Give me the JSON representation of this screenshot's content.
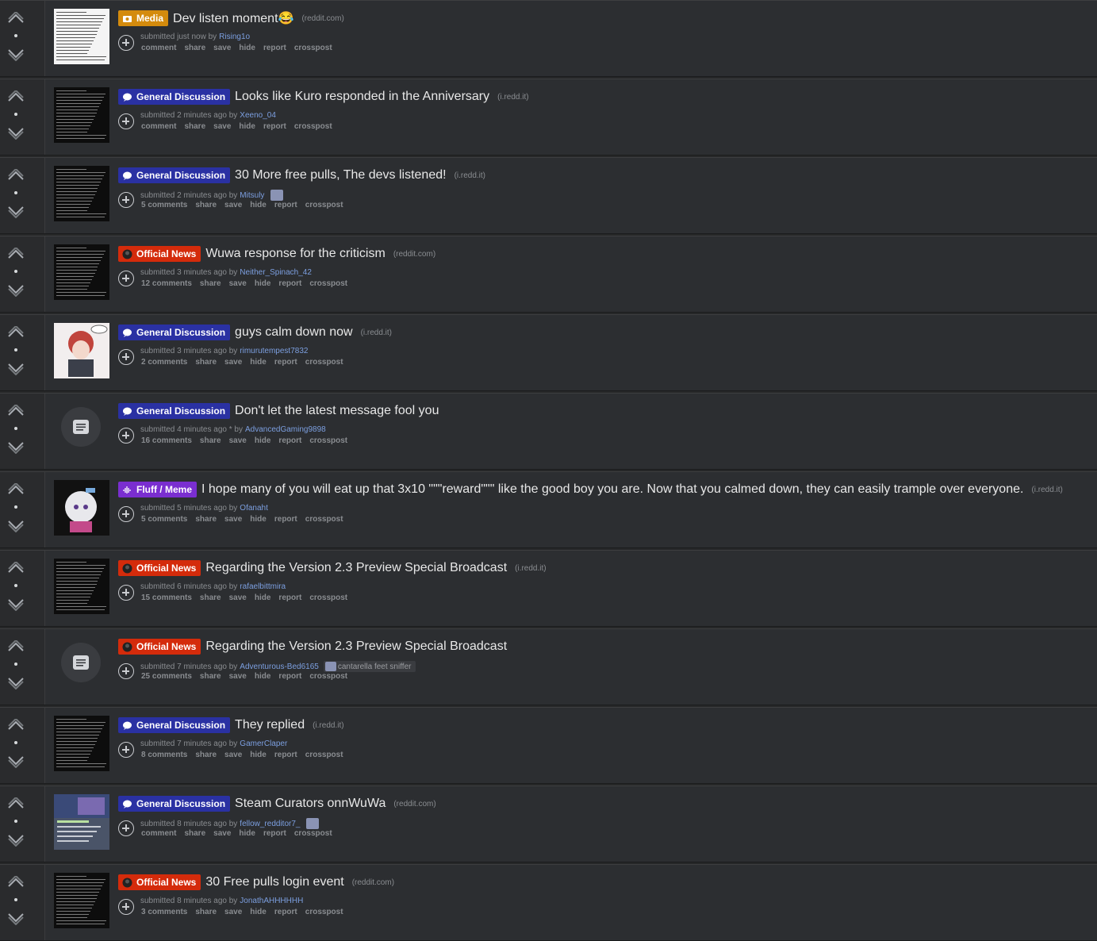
{
  "colors": {
    "media": "#d48b0d",
    "general_discussion": "#2a31a3",
    "official_news": "#d42b0b",
    "fluff_meme": "#7a2ed0"
  },
  "buttons": {
    "comment": "comment",
    "share": "share",
    "save": "save",
    "hide": "hide",
    "report": "report",
    "crosspost": "crosspost"
  },
  "posts": [
    {
      "flair": "Media",
      "flair_type": "media",
      "title": "Dev listen moment😂",
      "domain": "(reddit.com)",
      "submitted": "submitted just now by",
      "author": "Rising1o",
      "comments": "comment",
      "thumb": "light"
    },
    {
      "flair": "General Discussion",
      "flair_type": "gd",
      "title": "Looks like Kuro responded in the Anniversary",
      "domain": "(i.redd.it)",
      "submitted": "submitted 2 minutes ago by",
      "author": "Xeeno_04",
      "comments": "comment",
      "thumb": "dark"
    },
    {
      "flair": "General Discussion",
      "flair_type": "gd",
      "title": "30 More free pulls, The devs listened!",
      "domain": "(i.redd.it)",
      "submitted": "submitted 2 minutes ago by",
      "author": "Mitsuly",
      "comments": "5 comments",
      "thumb": "dark",
      "avatar": true
    },
    {
      "flair": "Official News",
      "flair_type": "on",
      "title": "Wuwa response for the criticism",
      "domain": "(reddit.com)",
      "submitted": "submitted 3 minutes ago by",
      "author": "Neither_Spinach_42",
      "comments": "12 comments",
      "thumb": "dark"
    },
    {
      "flair": "General Discussion",
      "flair_type": "gd",
      "title": "guys calm down now",
      "domain": "(i.redd.it)",
      "submitted": "submitted 3 minutes ago by",
      "author": "rimurutempest7832",
      "comments": "2 comments",
      "thumb": "art"
    },
    {
      "flair": "General Discussion",
      "flair_type": "gd",
      "title": "Don't let the latest message fool you",
      "domain": "",
      "submitted": "submitted 4 minutes ago * by",
      "author": "AdvancedGaming9898",
      "comments": "16 comments",
      "thumb": "self"
    },
    {
      "flair": "Fluff / Meme",
      "flair_type": "fm",
      "title": "I hope many of you will eat up that 3x10 \"\"\"reward\"\"\" like the good boy you are. Now that you calmed down, they can easily trample over everyone.",
      "domain": "(i.redd.it)",
      "submitted": "submitted 5 minutes ago by",
      "author": "Ofanaht",
      "comments": "5 comments",
      "thumb": "art2"
    },
    {
      "flair": "Official News",
      "flair_type": "on",
      "title": "Regarding the Version 2.3 Preview Special Broadcast",
      "domain": "(i.redd.it)",
      "submitted": "submitted 6 minutes ago by",
      "author": "rafaelbittmira",
      "comments": "15 comments",
      "thumb": "dark"
    },
    {
      "flair": "Official News",
      "flair_type": "on",
      "title": "Regarding the Version 2.3 Preview Special Broadcast",
      "domain": "",
      "submitted": "submitted 7 minutes ago by",
      "author": "Adventurous-Bed6165",
      "comments": "25 comments",
      "thumb": "self",
      "user_flair": "cantarella feet sniffer"
    },
    {
      "flair": "General Discussion",
      "flair_type": "gd",
      "title": "They replied",
      "domain": "(i.redd.it)",
      "submitted": "submitted 7 minutes ago by",
      "author": "GamerClaper",
      "comments": "8 comments",
      "thumb": "dark"
    },
    {
      "flair": "General Discussion",
      "flair_type": "gd",
      "title": "Steam Curators onnWuWa",
      "domain": "(reddit.com)",
      "submitted": "submitted 8 minutes ago by",
      "author": "fellow_redditor7_",
      "comments": "comment",
      "thumb": "steam",
      "avatar": true
    },
    {
      "flair": "Official News",
      "flair_type": "on",
      "title": "30 Free pulls login event",
      "domain": "(reddit.com)",
      "submitted": "submitted 8 minutes ago by",
      "author": "JonathAHHHHHH",
      "comments": "3 comments",
      "thumb": "dark"
    }
  ]
}
